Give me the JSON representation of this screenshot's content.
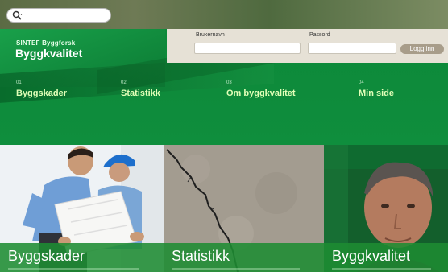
{
  "search": {
    "placeholder": ""
  },
  "brand": {
    "org": "SINTEF Byggforsk",
    "title": "Byggkvalitet"
  },
  "login": {
    "username_label": "Brukernavn",
    "password_label": "Passord",
    "button_label": "Logg inn"
  },
  "nav": [
    {
      "num": "01",
      "label": "Byggskader"
    },
    {
      "num": "02",
      "label": "Statistikk"
    },
    {
      "num": "03",
      "label": "Om byggkvalitet"
    },
    {
      "num": "04",
      "label": "Min side"
    }
  ],
  "panels": [
    {
      "caption": "Byggskader"
    },
    {
      "caption": "Statistikk"
    },
    {
      "caption": "Byggkvalitet"
    }
  ],
  "colors": {
    "brand_green": "#0e8b3b",
    "nav_text": "#e2ffb8",
    "login_bg": "#e6e1d6"
  }
}
